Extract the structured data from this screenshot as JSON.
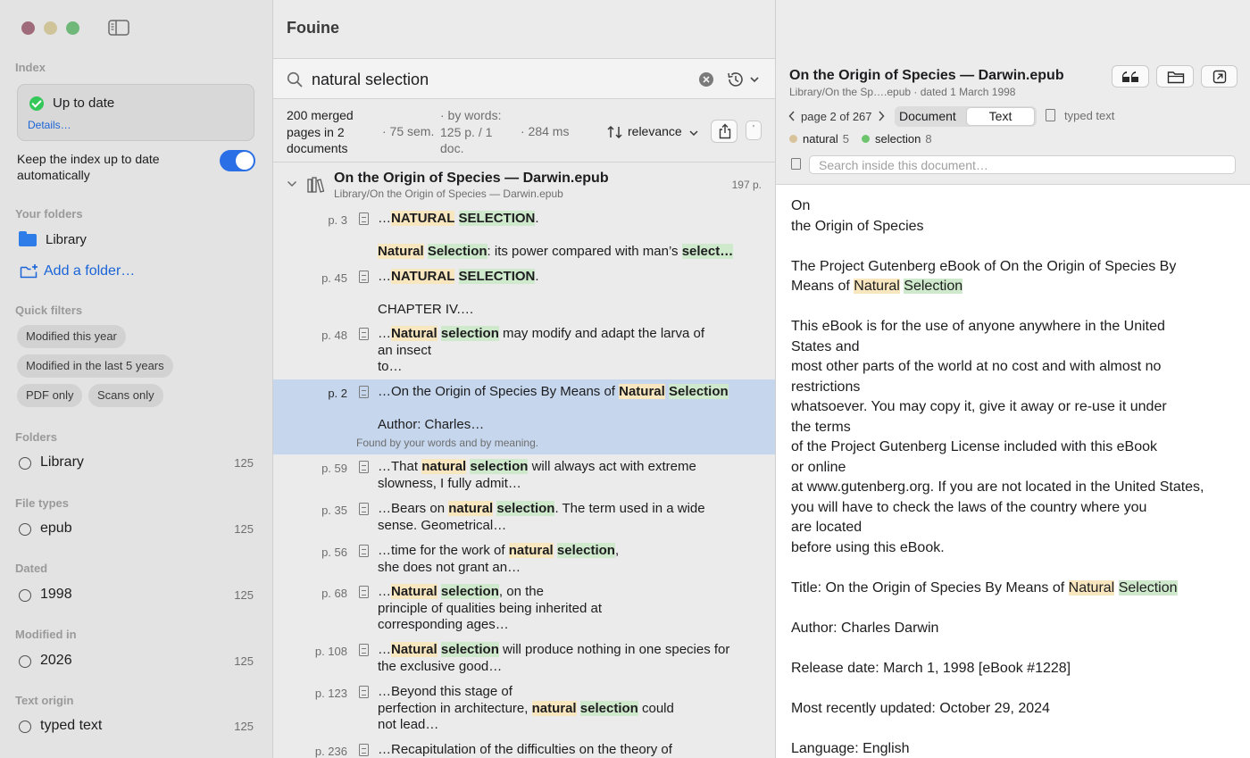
{
  "sidebar": {
    "index_heading": "Index",
    "index_status": "Up to date",
    "index_details": "Details…",
    "keep_updated": "Keep the index up to date automatically",
    "folders_heading": "Your folders",
    "folder_name": "Library",
    "add_folder": "Add a folder…",
    "quick_filters_heading": "Quick filters",
    "quick_filters": [
      "Modified this year",
      "Modified in the last 5 years",
      "PDF only",
      "Scans only"
    ],
    "groups": [
      {
        "heading": "Folders",
        "item": "Library",
        "count": "125"
      },
      {
        "heading": "File types",
        "item": "epub",
        "count": "125"
      },
      {
        "heading": "Dated",
        "item": "1998",
        "count": "125"
      },
      {
        "heading": "Modified in",
        "item": "2026",
        "count": "125"
      },
      {
        "heading": "Text origin",
        "item": "typed text",
        "count": "125"
      }
    ]
  },
  "app": {
    "title": "Fouine"
  },
  "search": {
    "query": "natural selection"
  },
  "stats": {
    "merged": "200 merged pages in 2 documents",
    "sem": "· 75 sem.",
    "by_words": "· by words: 125 p. / 1 doc.",
    "time": "· 284 ms",
    "sort": "relevance",
    "mini": "'"
  },
  "document": {
    "title": "On the Origin of Species — Darwin.epub",
    "path": "Library/On the Origin of Species — Darwin.epub",
    "pages": "197 p."
  },
  "results": [
    {
      "page": "p. 3"
    },
    {
      "page": "p. 45"
    },
    {
      "page": "p. 48"
    },
    {
      "page": "p. 2",
      "note": "Found by your words and by meaning."
    },
    {
      "page": "p. 59"
    },
    {
      "page": "p. 35"
    },
    {
      "page": "p. 56"
    },
    {
      "page": "p. 68"
    },
    {
      "page": "p. 108"
    },
    {
      "page": "p. 123"
    },
    {
      "page": "p. 236"
    }
  ],
  "snippets": {
    "r0a": "…",
    "r0b": "NATURAL",
    "r0c": "SELECTION",
    "r0d": ".",
    "r0e": "Natural",
    "r0f": "Selection",
    "r0g": ": its power compared with man’s ",
    "r0h": "select…",
    "r1a": "…",
    "r1b": "NATURAL",
    "r1c": "SELECTION",
    "r1d": ".",
    "r1e": "CHAPTER IV.…",
    "r2a": "…",
    "r2b": "Natural",
    "r2c": "selection",
    "r2d": " may modify and adapt the larva of",
    "r2e": "an insect",
    "r2f": "to…",
    "r3a": "…On the Origin of Species By Means of ",
    "r3b": "Natural",
    "r3c": "Selection",
    "r3d": "Author: Charles…",
    "r4a": "…That ",
    "r4b": "natural",
    "r4c": "selection",
    "r4d": " will always act with extreme",
    "r4e": "slowness, I fully admit…",
    "r5a": "…Bears on ",
    "r5b": "natural",
    "r5c": "selection",
    "r5d": ". The term used in a wide",
    "r5e": "sense. Geometrical…",
    "r6a": "…time for the work of ",
    "r6b": "natural",
    "r6c": "selection",
    "r6d": ",",
    "r6e": "she does not grant an…",
    "r7a": "…",
    "r7b": "Natural",
    "r7c": "selection",
    "r7d": ", on the",
    "r7e": "principle of qualities being inherited at",
    "r7f": "corresponding ages…",
    "r8a": "…",
    "r8b": "Natural",
    "r8c": "selection",
    "r8d": " will produce nothing in one species for",
    "r8e": "the exclusive good…",
    "r9a": "…Beyond this stage of",
    "r9b": "perfection in architecture, ",
    "r9c": "natural",
    "r9d": "selection",
    "r9e": " could",
    "r9f": "not lead…",
    "r10a": "…Recapitulation of the difficulties on the theory of"
  },
  "preview": {
    "title": "On the Origin of Species — Darwin.epub",
    "subtitle": "Library/On the Sp….epub · dated 1 March 1998",
    "pager": "page 2 of 267",
    "tab_document": "Document",
    "tab_text": "Text",
    "origin": "typed text",
    "term1": "natural",
    "term1_count": "5",
    "term2": "selection",
    "term2_count": "8",
    "search_placeholder": "Search inside this document…",
    "lines": {
      "l1": "On",
      "l2": "the Origin of Species",
      "l3": "The Project Gutenberg eBook of On the Origin of Species By",
      "l4a": "Means of ",
      "l4b": "Natural",
      "l4c": "Selection",
      "l5": "This eBook is for the use of anyone anywhere in the United",
      "l6": "States and",
      "l7": "most other parts of the world at no cost and with almost no",
      "l8": "restrictions",
      "l9": "whatsoever. You may copy it, give it away or re-use it under",
      "l10": "the terms",
      "l11": "of the Project Gutenberg License included with this eBook",
      "l12": "or online",
      "l13": "at www.gutenberg.org. If you are not located in the United States,",
      "l14": "you will have to check the laws of the country where you",
      "l15": "are located",
      "l16": "before using this eBook.",
      "l17a": "Title: On the Origin of Species By Means of ",
      "l17b": "Natural",
      "l17c": "Selection",
      "l18": "Author: Charles Darwin",
      "l19": "Release date: March 1, 1998 [eBook #1228]",
      "l20": "Most recently updated: October 29, 2024",
      "l21": "Language: English"
    }
  },
  "colors": {
    "accent": "#2a6fe6",
    "highlight_natural": "#f8e6bf",
    "highlight_selection": "#cfe9cc",
    "selected_row": "#c5d6ed",
    "dot_natural": "#d9c39a",
    "dot_selection": "#6cc46c"
  }
}
